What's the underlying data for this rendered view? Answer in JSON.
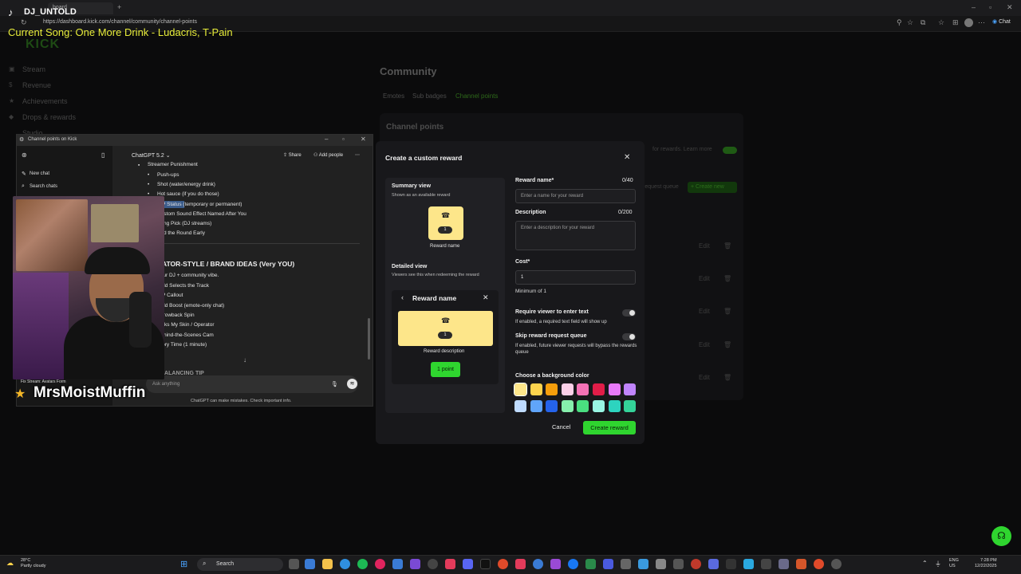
{
  "browser": {
    "tab_label": "board",
    "url": "https://dashboard.kick.com/channel/community/channel-points",
    "profile_label": "Chat"
  },
  "overlay": {
    "streamer_name": "DJ_UNTOLD",
    "current_song": "Current Song: One More Drink - Ludacris, T-Pain",
    "donor_name": "MrsMoistMuffin",
    "donor_small": "Fix Stream: Avatars Form"
  },
  "kick": {
    "logo": "KICK",
    "nav": [
      "Stream",
      "Revenue",
      "Achievements",
      "Drops & rewards",
      "Studio"
    ],
    "page_title": "Community",
    "tabs": [
      "Emotes",
      "Sub badges",
      "Channel points"
    ],
    "section_title": "Channel points",
    "rewards_hint": "for rewards. Learn more",
    "request_queue": "request queue",
    "create_new": "+ Create new",
    "edit_label": "Edit",
    "accent": "#53fc18"
  },
  "chatgpt": {
    "window_title": "Channel points on Kick",
    "new_chat": "New chat",
    "search_chats": "Search chats",
    "model": "ChatGPT 5.2",
    "share": "Share",
    "add_people": "Add people",
    "list_top": [
      "Streamer Punishment",
      "Push-ups",
      "Shot (water/energy drink)",
      "Hot sauce (if you do those)",
      "VIP Status (temporary or permanent)",
      "Custom Sound Effect Named After You",
      "Song Pick (DJ streams)",
      "End the Round Early"
    ],
    "heading": "CREATOR-STYLE / BRAND IDEAS (Very YOU)",
    "heading_sub": "Your DJ + community vibe.",
    "list_bottom": [
      "Hold Selects the Track",
      "VIP Callout",
      "Hold Boost (emote-only chat)",
      "Throwback Spin",
      "Picks My Skin / Operator",
      "Behind-the-Scenes Cam",
      "Story Time (1 minute)"
    ],
    "partial_heading": "BALANCING TIP",
    "input_placeholder": "Ask anything",
    "disclaimer": "ChatGPT can make mistakes. Check important info."
  },
  "modal": {
    "title": "Create a custom reward",
    "summary_title": "Summary view",
    "summary_sub": "Shown as an available reward",
    "card_cost": "1",
    "reward_name_label": "Reward name",
    "detailed_title": "Detailed view",
    "detailed_sub": "Viewers see this when redeeming the reward",
    "detail_header": "Reward name",
    "reward_description": "Reward description",
    "point_button": "1 point",
    "name_field_label": "Reward name*",
    "name_counter": "0/40",
    "name_placeholder": "Enter a name for your reward",
    "desc_field_label": "Description",
    "desc_counter": "0/200",
    "desc_placeholder": "Enter a description for your reward",
    "cost_label": "Cost*",
    "cost_value": "1",
    "cost_hint": "Minimum of 1",
    "require_text_label": "Require viewer to enter text",
    "require_text_desc": "If enabled, a required text field will show up",
    "skip_queue_label": "Skip reward request queue",
    "skip_queue_desc": "If enabled, future viewer requests will bypass the rewards queue",
    "bg_color_label": "Choose a background color",
    "swatches_row1": [
      "#fde68a",
      "#fcd34d",
      "#f59e0b",
      "#fbcfe8",
      "#f472b6",
      "#e11d48",
      "#e879f9",
      "#c084fc"
    ],
    "swatches_row2": [
      "#bfdbfe",
      "#60a5fa",
      "#2563eb",
      "#86efac",
      "#4ade80",
      "#99f6e4",
      "#2dd4bf",
      "#34d399"
    ],
    "cancel": "Cancel",
    "create": "Create reward"
  },
  "taskbar": {
    "temp": "28°C",
    "weather": "Partly cloudy",
    "search": "Search",
    "lang1": "ENG",
    "lang2": "US",
    "time": "7:28 PM",
    "date": "12/22/2025"
  }
}
